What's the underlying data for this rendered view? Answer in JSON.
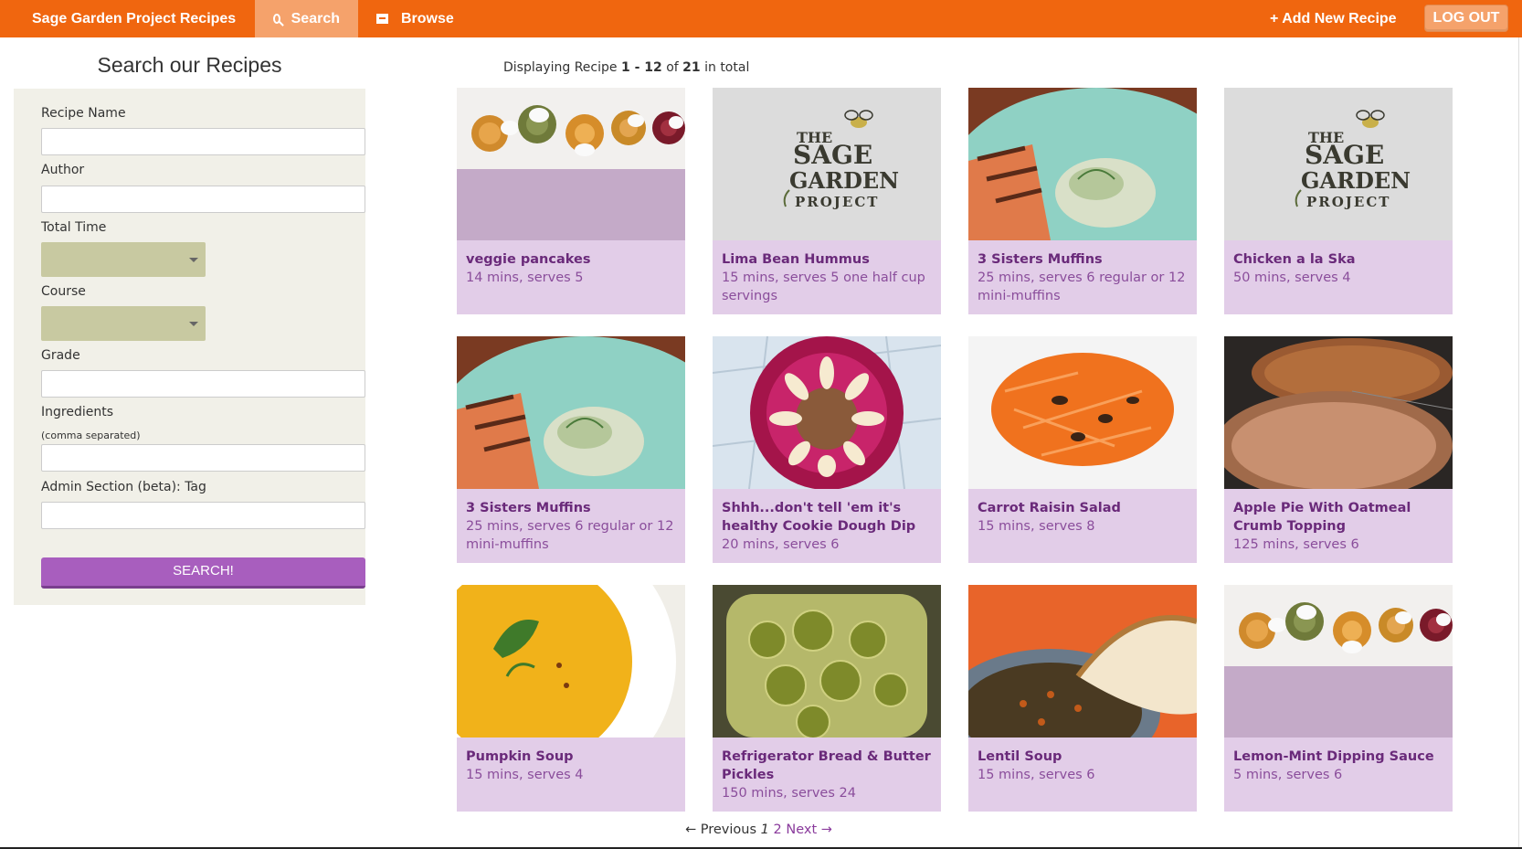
{
  "nav": {
    "brand": "Sage Garden Project Recipes",
    "search_tab": "Search",
    "browse_tab": "Browse",
    "add_recipe": "+ Add New Recipe",
    "logout": "LOG OUT",
    "accent_color": "#f0660f"
  },
  "sidebar": {
    "title": "Search our Recipes",
    "recipe_name_label": "Recipe Name",
    "recipe_name_value": "",
    "author_label": "Author",
    "author_value": "",
    "total_time_label": "Total Time",
    "total_time_value": "",
    "course_label": "Course",
    "course_value": "",
    "grade_label": "Grade",
    "grade_value": "",
    "ingredients_label": "Ingredients",
    "ingredients_hint": "(comma separated)",
    "ingredients_value": "",
    "tag_label": "Admin Section (beta): Tag",
    "tag_value": "",
    "search_button": "SEARCH!"
  },
  "results": {
    "prefix": "Displaying Recipe",
    "range": "1 - 12",
    "of": "of",
    "total": "21",
    "suffix": "in total"
  },
  "recipes": [
    {
      "title": "veggie pancakes",
      "meta": "14 mins, serves 5",
      "image": "pancakes"
    },
    {
      "title": "Lima Bean Hummus",
      "meta": "15 mins, serves 5 one half cup servings",
      "image": "logo"
    },
    {
      "title": "3 Sisters Muffins",
      "meta": "25 mins, serves 6 regular or 12 mini-muffins",
      "image": "salmon"
    },
    {
      "title": "Chicken a la Ska",
      "meta": "50 mins, serves 4",
      "image": "logo"
    },
    {
      "title": "3 Sisters Muffins",
      "meta": "25 mins, serves 6 regular or 12 mini-muffins",
      "image": "salmon"
    },
    {
      "title": "Shhh...don't tell 'em it's healthy Cookie Dough Dip",
      "meta": "20 mins, serves 6",
      "image": "dip"
    },
    {
      "title": "Carrot Raisin Salad",
      "meta": "15 mins, serves 8",
      "image": "carrot"
    },
    {
      "title": "Apple Pie With Oatmeal Crumb Topping",
      "meta": "125 mins, serves 6",
      "image": "pie"
    },
    {
      "title": "Pumpkin Soup",
      "meta": "15 mins, serves 4",
      "image": "soup"
    },
    {
      "title": "Refrigerator Bread & Butter Pickles",
      "meta": "150 mins, serves 24",
      "image": "pickles"
    },
    {
      "title": "Lentil Soup",
      "meta": "15 mins, serves 6",
      "image": "lentil"
    },
    {
      "title": "Lemon-Mint Dipping Sauce",
      "meta": "5 mins, serves 6",
      "image": "pancakes"
    }
  ],
  "logo_text": {
    "line1": "THE",
    "line2": "SAGE",
    "line3": "GARDEN",
    "line4": "PROJECT"
  },
  "pager": {
    "prev": "← Previous",
    "current": "1",
    "page2": "2",
    "next": "Next →"
  }
}
